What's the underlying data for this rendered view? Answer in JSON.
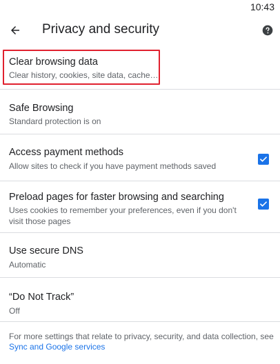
{
  "status_bar": {
    "time": "10:43"
  },
  "app_bar": {
    "back_icon": "arrow-back-icon",
    "title": "Privacy and security",
    "help_icon": "help-icon"
  },
  "settings": {
    "clear_browsing": {
      "title": "Clear browsing data",
      "subtitle": "Clear history, cookies, site data, cache…",
      "highlight_color": "#e0202e"
    },
    "safe_browsing": {
      "title": "Safe Browsing",
      "subtitle": "Standard protection is on"
    },
    "payment_methods": {
      "title": "Access payment methods",
      "subtitle": "Allow sites to check if you have payment methods saved",
      "checked": true
    },
    "preload_pages": {
      "title": "Preload pages for faster browsing and searching",
      "subtitle": "Uses cookies to remember your preferences, even if you don't visit those pages",
      "checked": true
    },
    "secure_dns": {
      "title": "Use secure DNS",
      "subtitle": "Automatic"
    },
    "do_not_track": {
      "title": "“Do Not Track”",
      "subtitle": "Off"
    }
  },
  "footer": {
    "text": "For more settings that relate to privacy, security, and data collection, see",
    "link": "Sync and Google services"
  },
  "colors": {
    "accent": "#1a73e8",
    "primary_text": "#202124",
    "secondary_text": "#5f6368",
    "divider": "#dadce0"
  }
}
